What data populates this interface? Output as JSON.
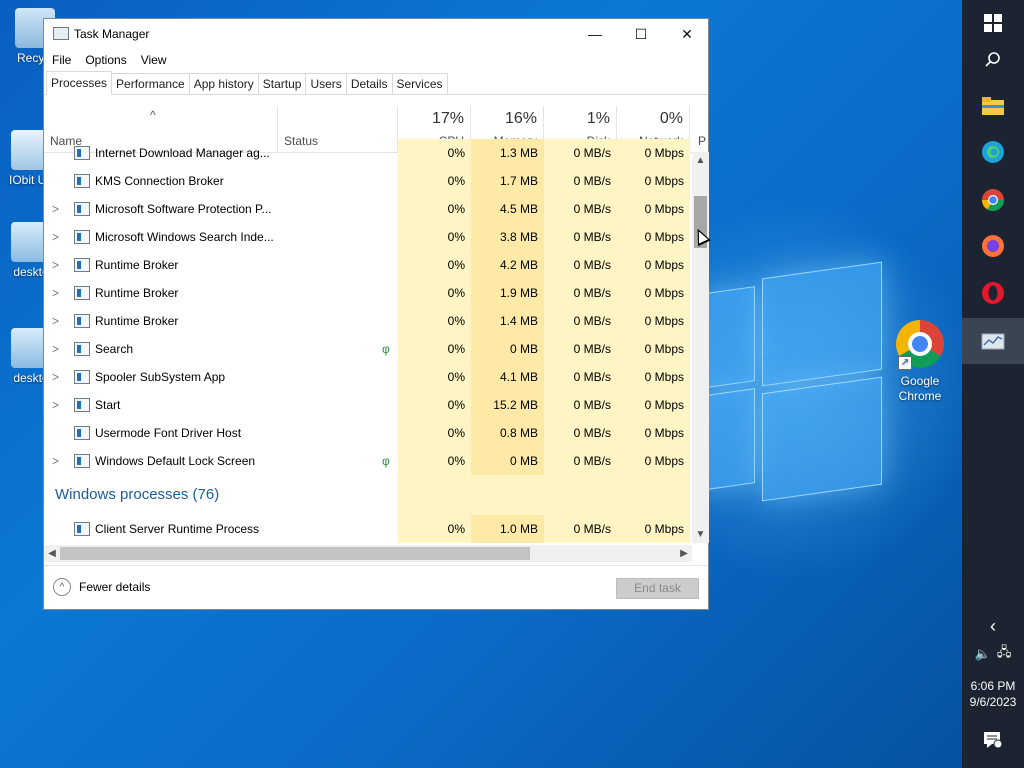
{
  "desktop": {
    "icons": [
      {
        "label": "Recycl",
        "icon": "recycle-bin-icon"
      },
      {
        "label": "IObit Un",
        "icon": "iobit-icon"
      },
      {
        "label": "deskto",
        "icon": "desktop-file-icon"
      },
      {
        "label": "deskto",
        "icon": "desktop-file-icon"
      }
    ],
    "chrome_shortcut": {
      "line1": "Google",
      "line2": "Chrome"
    }
  },
  "taskbar": {
    "buttons": [
      "windows-start-icon",
      "search-icon",
      "file-explorer-icon",
      "edge-icon",
      "chrome-icon",
      "firefox-icon",
      "opera-icon",
      "task-manager-icon"
    ],
    "tray": {
      "chevron": "‹",
      "time": "6:06 PM",
      "date": "9/6/2023"
    }
  },
  "window": {
    "title": "Task Manager",
    "controls": {
      "minimize": "—",
      "maximize": "☐",
      "close": "✕"
    },
    "menu": [
      "File",
      "Options",
      "View"
    ],
    "tabs": [
      "Processes",
      "Performance",
      "App history",
      "Startup",
      "Users",
      "Details",
      "Services"
    ],
    "active_tab": "Processes"
  },
  "columns": {
    "name": "Name",
    "status": "Status",
    "cpu": {
      "pct": "17%",
      "label": "CPU"
    },
    "memory": {
      "pct": "16%",
      "label": "Memory"
    },
    "disk": {
      "pct": "1%",
      "label": "Disk"
    },
    "network": {
      "pct": "0%",
      "label": "Network"
    },
    "power": {
      "label": "P"
    }
  },
  "rows": [
    {
      "name": "Internet Download Manager ag...",
      "expand": "",
      "leaf": "",
      "cpu": "0%",
      "mem": "1.3 MB",
      "disk": "0 MB/s",
      "net": "0 Mbps"
    },
    {
      "name": "KMS Connection Broker",
      "expand": "",
      "leaf": "",
      "cpu": "0%",
      "mem": "1.7 MB",
      "disk": "0 MB/s",
      "net": "0 Mbps"
    },
    {
      "name": "Microsoft Software Protection P...",
      "expand": ">",
      "leaf": "",
      "cpu": "0%",
      "mem": "4.5 MB",
      "disk": "0 MB/s",
      "net": "0 Mbps"
    },
    {
      "name": "Microsoft Windows Search Inde...",
      "expand": ">",
      "leaf": "",
      "cpu": "0%",
      "mem": "3.8 MB",
      "disk": "0 MB/s",
      "net": "0 Mbps"
    },
    {
      "name": "Runtime Broker",
      "expand": ">",
      "leaf": "",
      "cpu": "0%",
      "mem": "4.2 MB",
      "disk": "0 MB/s",
      "net": "0 Mbps"
    },
    {
      "name": "Runtime Broker",
      "expand": ">",
      "leaf": "",
      "cpu": "0%",
      "mem": "1.9 MB",
      "disk": "0 MB/s",
      "net": "0 Mbps"
    },
    {
      "name": "Runtime Broker",
      "expand": ">",
      "leaf": "",
      "cpu": "0%",
      "mem": "1.4 MB",
      "disk": "0 MB/s",
      "net": "0 Mbps"
    },
    {
      "name": "Search",
      "expand": ">",
      "leaf": "φ",
      "cpu": "0%",
      "mem": "0 MB",
      "disk": "0 MB/s",
      "net": "0 Mbps"
    },
    {
      "name": "Spooler SubSystem App",
      "expand": ">",
      "leaf": "",
      "cpu": "0%",
      "mem": "4.1 MB",
      "disk": "0 MB/s",
      "net": "0 Mbps"
    },
    {
      "name": "Start",
      "expand": ">",
      "leaf": "",
      "cpu": "0%",
      "mem": "15.2 MB",
      "disk": "0 MB/s",
      "net": "0 Mbps"
    },
    {
      "name": "Usermode Font Driver Host",
      "expand": "",
      "leaf": "",
      "cpu": "0%",
      "mem": "0.8 MB",
      "disk": "0 MB/s",
      "net": "0 Mbps"
    },
    {
      "name": "Windows Default Lock Screen",
      "expand": ">",
      "leaf": "φ",
      "cpu": "0%",
      "mem": "0 MB",
      "disk": "0 MB/s",
      "net": "0 Mbps"
    }
  ],
  "group": {
    "title": "Windows processes (76)"
  },
  "group_rows": [
    {
      "name": "Client Server Runtime Process",
      "expand": "",
      "leaf": "",
      "cpu": "0%",
      "mem": "1.0 MB",
      "disk": "0 MB/s",
      "net": "0 Mbps"
    }
  ],
  "footer": {
    "fewer_details": "Fewer details",
    "end_task": "End task"
  },
  "colors": {
    "cpu_bg": "#fff4c4",
    "mem_bg": "#ffe9a6",
    "group_title": "#1c5c9c",
    "taskbar": "#1b2430"
  }
}
